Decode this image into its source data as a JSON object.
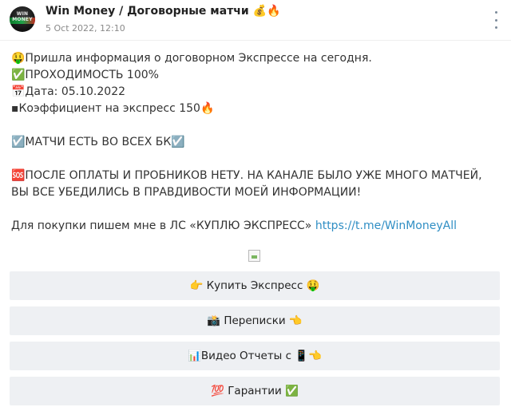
{
  "header": {
    "channel_name": "Win Money / Договорные матчи 💰🔥",
    "timestamp": "5 Oct 2022, 12:10",
    "avatar_text": "WIN MONEY"
  },
  "post": {
    "line1": "🤑Пришла информация о договорном Экспрессе на сегодня.",
    "line2": "✅ПРОХОДИМОСТЬ 100%",
    "line3": "📅Дата: 05.10.2022",
    "line4": "▪Коэффициент на экспресс 150🔥",
    "line5": "☑️МАТЧИ ЕСТЬ ВО ВСЕХ БК☑️",
    "line6": "🆘ПОСЛЕ ОПЛАТЫ И ПРОБНИКОВ НЕТУ. НА КАНАЛЕ БЫЛО УЖЕ МНОГО МАТЧЕЙ, ВЫ ВСЕ УБЕДИЛИСЬ В ПРАВДИВОСТИ МОЕЙ ИНФОРМАЦИИ!",
    "purchase_text": "Для покупки пишем мне в ЛС «КУПЛЮ ЭКСПРЕСС» ",
    "link": "https://t.me/WinMoneyAll"
  },
  "buttons": [
    {
      "label": "👉 Купить Экспресс 🤑"
    },
    {
      "label": "📸 Переписки 👈"
    },
    {
      "label": "📊Видео Отчеты с 📱👈"
    },
    {
      "label": "💯 Гарантии ✅"
    }
  ],
  "colors": {
    "link": "#2f8ec4",
    "button_bg": "#eef0f3",
    "timestamp": "#8a8a8a"
  }
}
